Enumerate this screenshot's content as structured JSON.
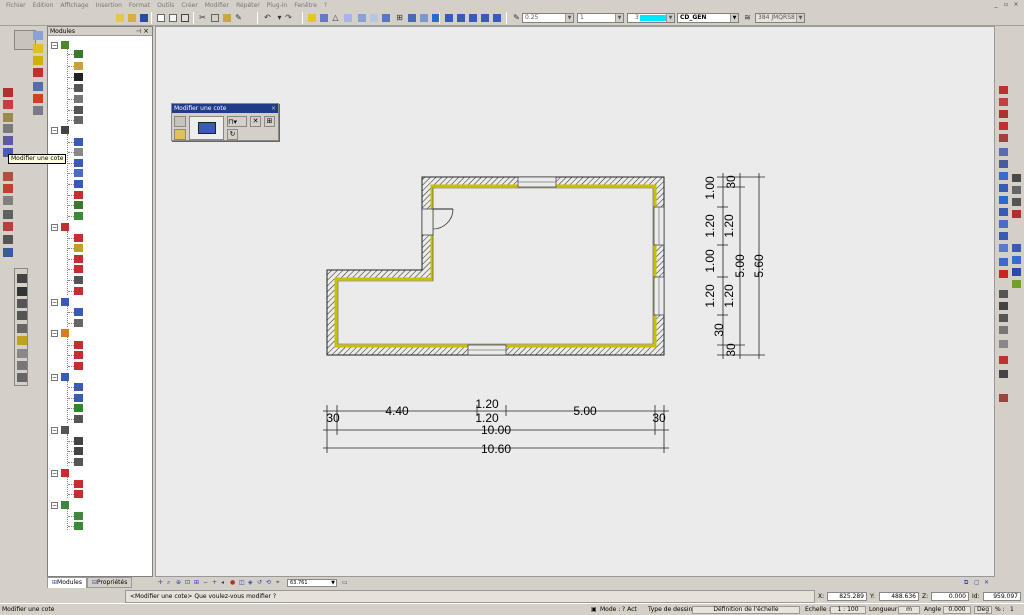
{
  "menu": [
    "Fichier",
    "Edition",
    "Affichage",
    "Insertion",
    "Format",
    "Outils",
    "Créer",
    "Modifier",
    "Répéter",
    "Plug-in",
    "Fenêtre",
    "?"
  ],
  "toolbar": {
    "pen_width": "0.25",
    "line_type": "1",
    "color_index": "3",
    "color_swatch": "#00e5ff",
    "layer": "CD_GEN",
    "layer_count": "384 JMQRS8"
  },
  "modules_panel": {
    "title": "Modules",
    "pin": "⌑",
    "close": "×",
    "tabs": [
      {
        "label": "Modules"
      },
      {
        "label": "Propriétés"
      }
    ]
  },
  "tooltip": "Modifier une cote",
  "palette": {
    "title": "Modifier une cote",
    "close": "×"
  },
  "drawing": {
    "dims_bottom": {
      "row1": [
        "30",
        "4.40",
        "1.20",
        "5.00",
        "30"
      ],
      "row1b": "1.20",
      "row2": "10.00",
      "row3": "10.60"
    },
    "dims_right": {
      "col1": [
        "30",
        "1.20",
        "1.20",
        "1.00",
        "1.20",
        "1.20",
        "1.00"
      ],
      "col1_bottom": "30",
      "col2": "5.00",
      "col3": "5.60",
      "col1_top": "30"
    }
  },
  "zoom_value": "63.761",
  "prompt": "<Modifier une cote> Que voulez-vous modifier ?",
  "coords": {
    "x_label": "X:",
    "x": "825.289",
    "y_label": "Y:",
    "y": "488.636",
    "z_label": "Z:",
    "z": "0.000",
    "id_label": "Id:",
    "id": "959.097"
  },
  "status": {
    "left": "Modifier une cote",
    "mode_label": "Mode :",
    "mode": "? Act",
    "type_label": "Type de dessin :",
    "type": "Définition de l'échelle",
    "scale_label": "Echelle :",
    "scale": "1 : 100",
    "length_label": "Longueur :",
    "length": "m",
    "angle_label": "Angle :",
    "angle": "0.000",
    "unit": "Deg",
    "percent_label": "% :",
    "percent": "1"
  }
}
